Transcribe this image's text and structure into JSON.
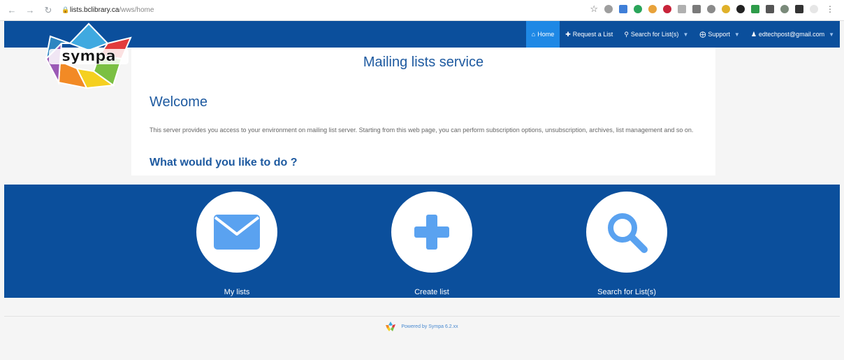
{
  "browser": {
    "url_host": "lists.bclibrary.ca",
    "url_path": "/wws/home"
  },
  "navbar": {
    "items": [
      {
        "label": "Home",
        "icon": "home-icon"
      },
      {
        "label": "Request a List",
        "icon": "plus-icon"
      },
      {
        "label": "Search for List(s)",
        "icon": "search-icon"
      },
      {
        "label": "Support",
        "icon": "lifebuoy-icon"
      },
      {
        "label": "edtechpost@gmail.com",
        "icon": "user-icon"
      }
    ]
  },
  "logo": {
    "text": "sympa"
  },
  "content": {
    "service_title": "Mailing lists service",
    "welcome_heading": "Welcome",
    "intro_text": "This server provides you access to your environment on mailing list server. Starting from this web page, you can perform subscription options, unsubscription, archives, list management and so on.",
    "question": "What would you like to do ?"
  },
  "actions": [
    {
      "label": "My lists",
      "icon": "envelope-icon"
    },
    {
      "label": "Create list",
      "icon": "plus-icon"
    },
    {
      "label": "Search for List(s)",
      "icon": "search-icon"
    }
  ],
  "footer": {
    "text": "Powered by Sympa 6.2.xx"
  },
  "colors": {
    "navbar_bg": "#0b4f9c",
    "active_tab": "#1e88e5",
    "heading": "#1e5aa0",
    "action_icon": "#5aa2f0"
  }
}
